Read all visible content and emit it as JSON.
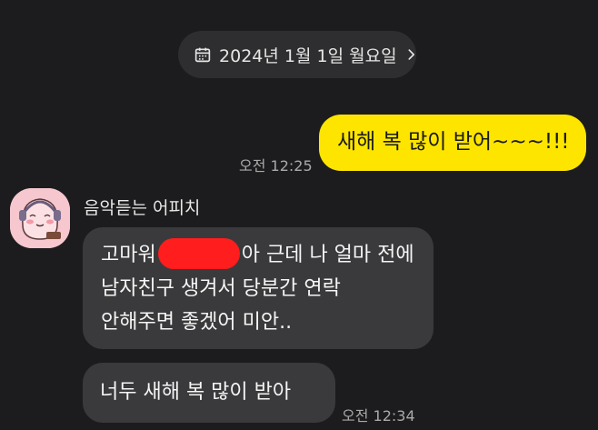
{
  "date_divider": {
    "label": "2024년 1월 1일 월요일",
    "icon": "calendar-icon",
    "chevron_icon": "chevron-right-icon"
  },
  "messages": [
    {
      "from": "me",
      "text": "새해 복 많이 받어~~~!!!",
      "time": "오전 12:25",
      "bubble_color": "#fee500"
    },
    {
      "from": "other",
      "sender_name": "음악듣는 어피치",
      "avatar": "apeach-avatar",
      "lines": [
        {
          "before_redaction": "고마워",
          "after_redaction": "아 근데 나 얼마 전에"
        },
        {
          "text": "남자친구 생겨서 당분간 연락"
        },
        {
          "text": "안해주면 좋겠어 미안.."
        }
      ],
      "redaction_color": "#ff1d1d",
      "bubble_color": "#3a3a3c"
    },
    {
      "from": "other",
      "text": "너두 새해 복 많이 받아",
      "time": "오전 12:34",
      "bubble_color": "#3a3a3c"
    }
  ]
}
